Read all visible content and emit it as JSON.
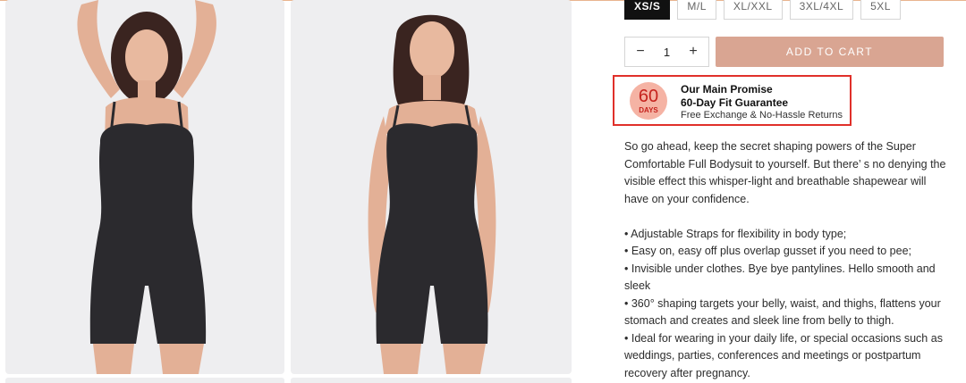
{
  "sizes": [
    {
      "label": "XS/S",
      "selected": true
    },
    {
      "label": "M/L",
      "selected": false
    },
    {
      "label": "XL/XXL",
      "selected": false
    },
    {
      "label": "3XL/4XL",
      "selected": false
    },
    {
      "label": "5XL",
      "selected": false
    }
  ],
  "quantity": {
    "value": "1",
    "minus": "−",
    "plus": "+"
  },
  "add_to_cart": "ADD TO CART",
  "promise": {
    "badge_number": "60",
    "badge_unit": "DAYS",
    "title": "Our Main Promise",
    "subtitle": "60-Day Fit Guarantee",
    "note": "Free Exchange & No-Hassle Returns"
  },
  "description": {
    "intro": "So go ahead, keep the secret shaping powers of the Super Comfortable Full Bodysuit to yourself. But there’ s no denying the visible effect this whisper-light and breathable shapewear will have on your confidence.",
    "bullets": [
      "• Adjustable Straps for flexibility in body type;",
      "• Easy on, easy off plus overlap gusset if you need to pee;",
      "• Invisible under clothes. Bye bye pantylines. Hello smooth and sleek",
      "• 360° shaping targets your belly, waist, and thighs, flattens your stomach and creates and sleek line from belly to thigh.",
      "• Ideal for wearing in your daily life, or special occasions such as weddings, parties, conferences and meetings or postpartum recovery after pregnancy."
    ]
  },
  "colors": {
    "accent": "#d9a592",
    "highlight_border": "#e0302a",
    "badge_bg": "#f5b3a4",
    "garment": "#2b2a2e",
    "skin": "#e3b096",
    "photo_bg": "#eeeef0"
  }
}
